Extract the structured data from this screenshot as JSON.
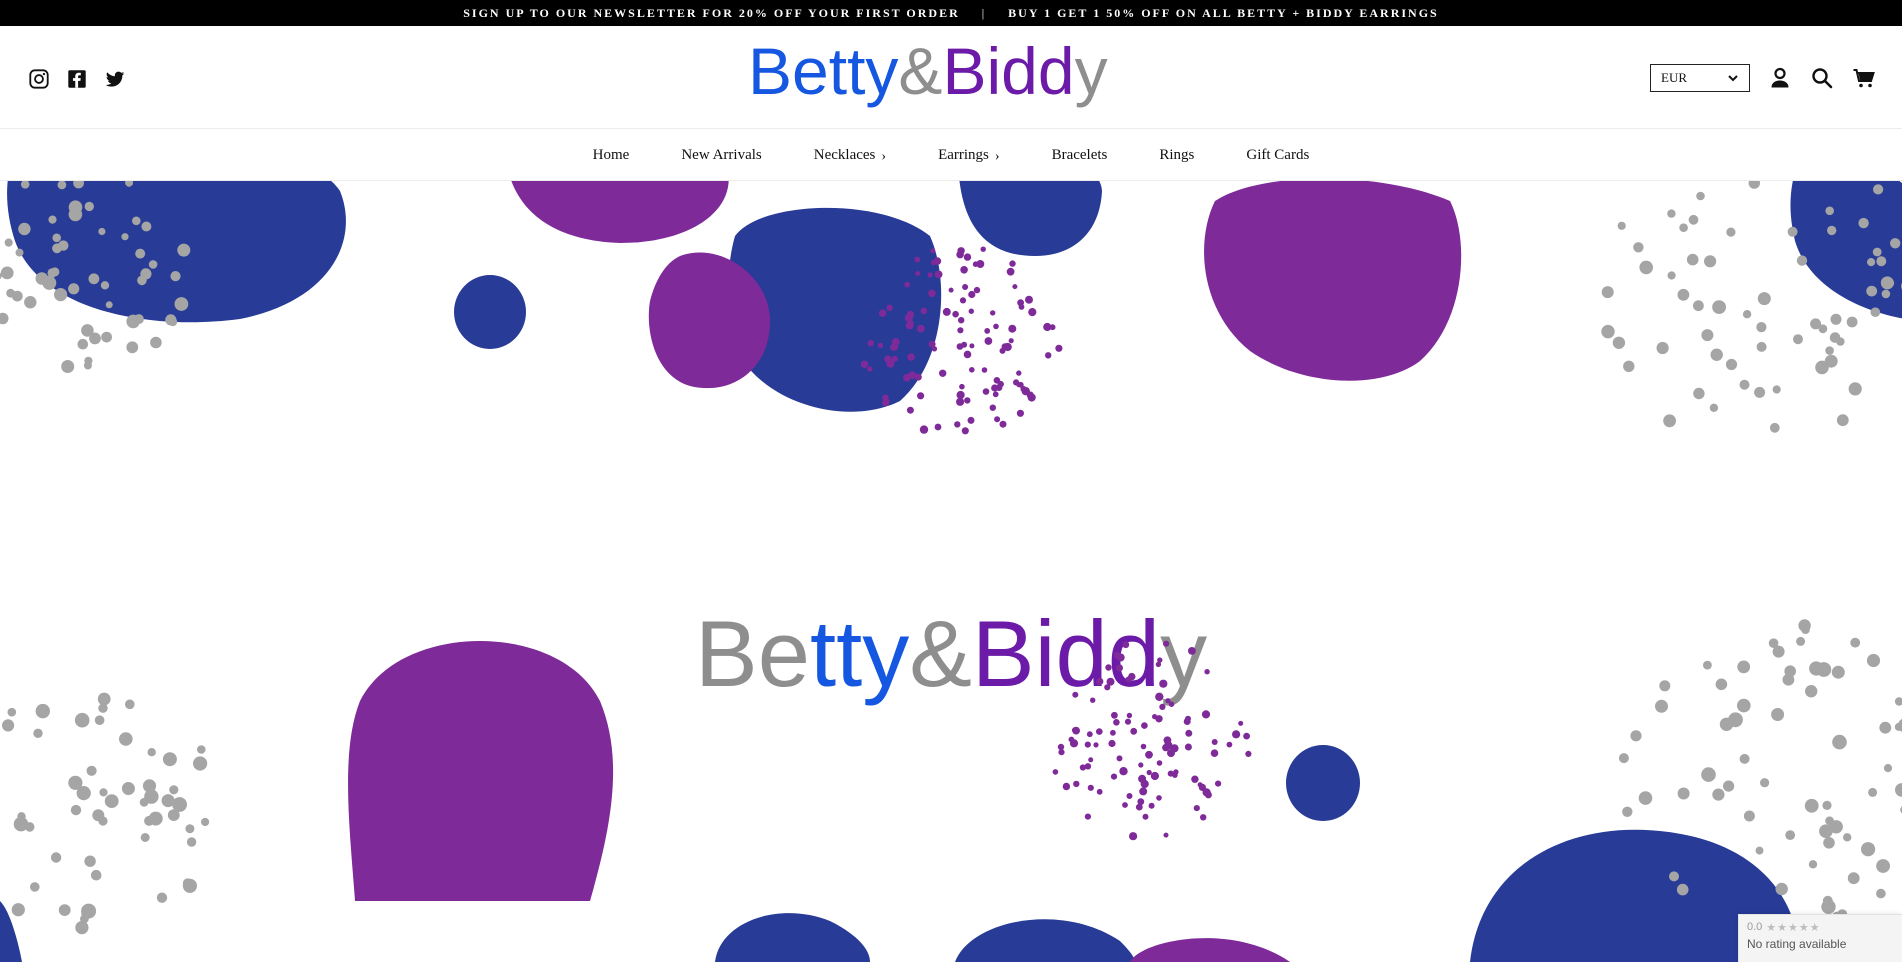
{
  "announcement": {
    "left": "SIGN UP TO OUR NEWSLETTER FOR 20% OFF YOUR FIRST ORDER",
    "separator": "|",
    "right": "BUY 1 GET 1 50% OFF ON ALL BETTY + BIDDY EARRINGS"
  },
  "header": {
    "logo_text": {
      "part1": "Be",
      "part2": "tty",
      "part3": "&",
      "part4": "B",
      "part5": "idd",
      "part6": "y"
    },
    "social_icons": [
      "instagram-icon",
      "facebook-icon",
      "twitter-icon"
    ],
    "currency": "EUR"
  },
  "nav": {
    "items": [
      {
        "label": "Home"
      },
      {
        "label": "New Arrivals"
      },
      {
        "label": "Necklaces",
        "chevron": "›"
      },
      {
        "label": "Earrings",
        "chevron": "›"
      },
      {
        "label": "Bracelets"
      },
      {
        "label": "Rings"
      },
      {
        "label": "Gift Cards"
      }
    ]
  },
  "hero": {
    "logo_text": {
      "part1": "Be",
      "part2": "tty",
      "part3": "&",
      "part4": "B",
      "part5": "idd",
      "part6": "y"
    }
  },
  "rating_badge": {
    "score": "0.0",
    "stars": "★★★★★",
    "text": "No rating available"
  },
  "colors": {
    "blue": "#283b96",
    "purple": "#7f2a99",
    "grey_dot": "#a5a5a5",
    "logo_grey": "#8e8e8e",
    "logo_blue": "#1557e0",
    "logo_purple": "#6c1aa8"
  }
}
